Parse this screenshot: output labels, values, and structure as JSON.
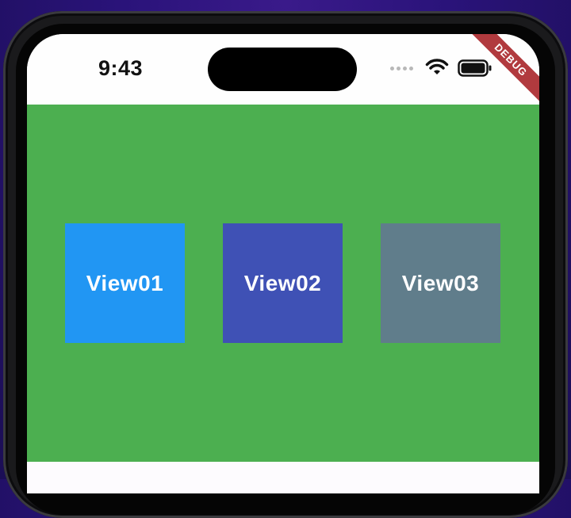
{
  "status_bar": {
    "time": "9:43"
  },
  "debug_banner": {
    "label": "DEBUG",
    "color": "#b13a3e"
  },
  "content": {
    "background": "#4caf50"
  },
  "views": [
    {
      "label": "View01",
      "color": "#2196f3"
    },
    {
      "label": "View02",
      "color": "#3f51b5"
    },
    {
      "label": "View03",
      "color": "#607d8b"
    }
  ]
}
